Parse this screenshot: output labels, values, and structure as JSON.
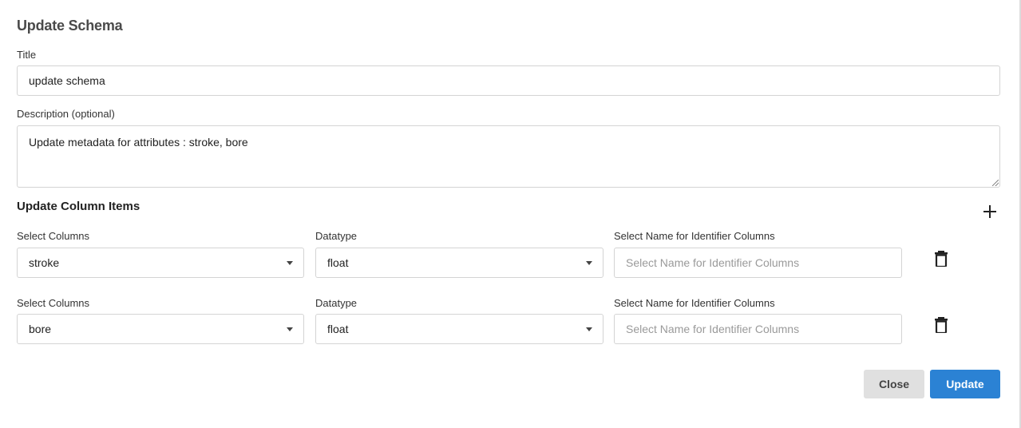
{
  "dialog": {
    "title": "Update Schema"
  },
  "form": {
    "title_label": "Title",
    "title_value": "update schema",
    "description_label": "Description (optional)",
    "description_value": "Update metadata for attributes : stroke, bore"
  },
  "column_items": {
    "section_title": "Update Column Items",
    "add_icon": "plus-icon",
    "delete_icon": "trash-icon",
    "rows": [
      {
        "columns_label": "Select Columns",
        "column_value": "stroke",
        "datatype_label": "Datatype",
        "datatype_value": "float",
        "identifier_label": "Select Name for Identifier Columns",
        "identifier_placeholder": "Select Name for Identifier Columns"
      },
      {
        "columns_label": "Select Columns",
        "column_value": "bore",
        "datatype_label": "Datatype",
        "datatype_value": "float",
        "identifier_label": "Select Name for Identifier Columns",
        "identifier_placeholder": "Select Name for Identifier Columns"
      }
    ]
  },
  "footer": {
    "close_label": "Close",
    "update_label": "Update"
  },
  "colors": {
    "primary": "#2b82d4",
    "secondary": "#e0e0e0"
  }
}
